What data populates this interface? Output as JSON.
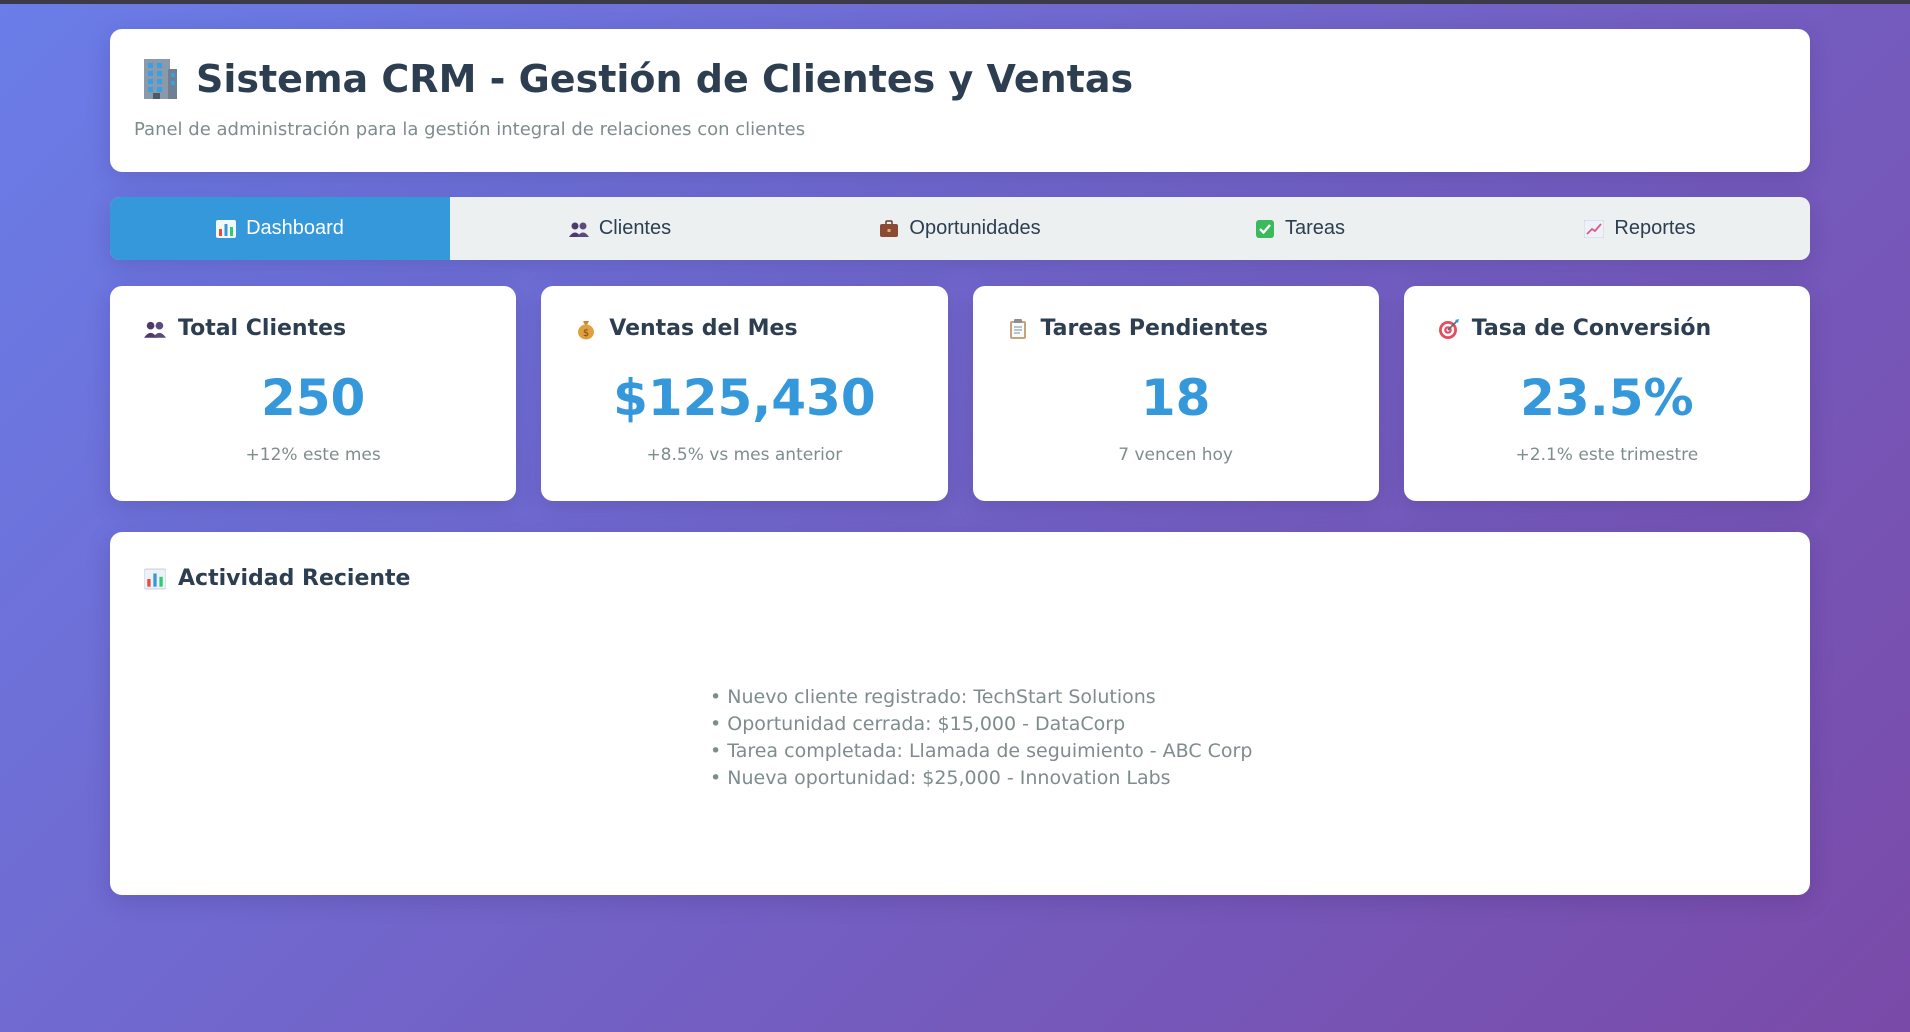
{
  "header": {
    "title": "Sistema CRM - Gestión de Clientes y Ventas",
    "subtitle": "Panel de administración para la gestión integral de relaciones con clientes",
    "icon": "building-icon"
  },
  "tabs": [
    {
      "label": "Dashboard",
      "icon": "bar-chart-icon",
      "active": true
    },
    {
      "label": "Clientes",
      "icon": "users-icon",
      "active": false
    },
    {
      "label": "Oportunidades",
      "icon": "briefcase-icon",
      "active": false
    },
    {
      "label": "Tareas",
      "icon": "check-icon",
      "active": false
    },
    {
      "label": "Reportes",
      "icon": "trend-chart-icon",
      "active": false
    }
  ],
  "cards": [
    {
      "title": "Total Clientes",
      "value": "250",
      "sub": "+12% este mes",
      "icon": "users-icon"
    },
    {
      "title": "Ventas del Mes",
      "value": "$125,430",
      "sub": "+8.5% vs mes anterior",
      "icon": "money-bag-icon"
    },
    {
      "title": "Tareas Pendientes",
      "value": "18",
      "sub": "7 vencen hoy",
      "icon": "clipboard-icon"
    },
    {
      "title": "Tasa de Conversión",
      "value": "23.5%",
      "sub": "+2.1% este trimestre",
      "icon": "target-icon"
    }
  ],
  "activity": {
    "title": "Actividad Reciente",
    "icon": "bar-chart-icon",
    "items": [
      "• Nuevo cliente registrado: TechStart Solutions",
      "• Oportunidad cerrada: $15,000 - DataCorp",
      "• Tarea completada: Llamada de seguimiento - ABC Corp",
      "• Nueva oportunidad: $25,000 - Innovation Labs"
    ]
  },
  "colors": {
    "accent": "#3498db",
    "text": "#2c3e50",
    "muted": "#7f8c8d",
    "tab_bg": "#ecf0f1"
  }
}
